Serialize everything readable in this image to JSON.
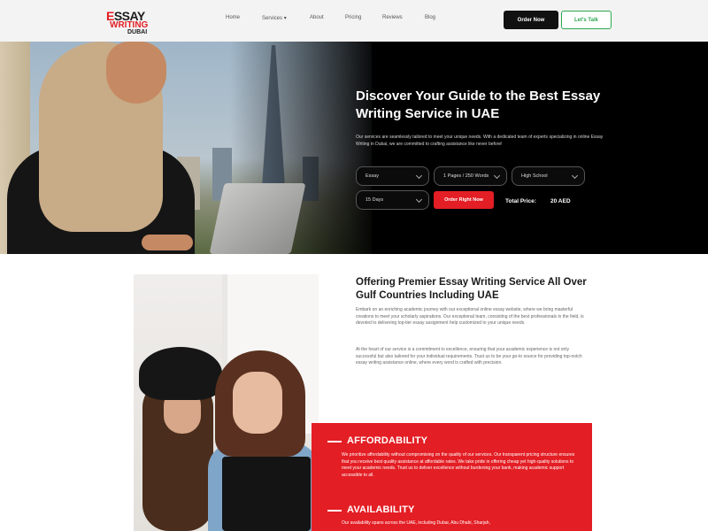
{
  "brand": {
    "line1_prefix": "E",
    "line1_rest": "SSAY",
    "line2": "WRITING",
    "line3": "DUBAI"
  },
  "nav": {
    "items": [
      "Home",
      "Services",
      "About",
      "Pricing",
      "Reviews",
      "Blog"
    ]
  },
  "header_buttons": {
    "order": "Order Now",
    "talk": "Let's Talk"
  },
  "hero": {
    "title": "Discover Your Guide to the Best Essay Writing Service in UAE",
    "description": "Our services are seamlessly tailored to meet your unique needs. With a dedicated team of experts specializing in online Essay Writing in Dubai, we are committed to crafting assistance like never before!",
    "order_form": {
      "paper_type": "Essay",
      "pages": "1 Pages / 250 Words",
      "level": "High School",
      "deadline": "15 Days",
      "submit": "Order Right Now",
      "total_label": "Total Price:",
      "total_value": "20 AED"
    }
  },
  "section": {
    "title": "Offering Premier Essay Writing Service All Over Gulf Countries Including UAE",
    "para1": "Embark on an enriching academic journey with our exceptional online essay website, where we bring masterful creations to meet your scholarly aspirations. Our exceptional team, consisting of the best professionals in the field, is devoted to delivering top-tier essay assignment help customized to your unique needs.",
    "para2": "At the heart of our service is a commitment to excellence, ensuring that your academic experience is not only successful but also tailored for your individual requirements. Trust us to be your go-to source for providing top-notch essay writing assistance online, where every word is crafted with precision."
  },
  "features": [
    {
      "title": "AFFORDABILITY",
      "text": "We prioritize affordability without compromising on the quality of our services. Our transparent pricing structure ensures that you receive best quality assistance at affordable rates. We take pride in offering cheap yet high-quality solutions to meet your academic needs. Trust us to deliver excellence without burdening your bank, making academic support accessible to all."
    },
    {
      "title": "AVAILABILITY",
      "text": "Our availability spans across the UAE, including Dubai, Abu Dhabi, Sharjah,"
    }
  ],
  "colors": {
    "accent_red": "#e31e24",
    "accent_green": "#2ea84f",
    "dark": "#111111"
  }
}
